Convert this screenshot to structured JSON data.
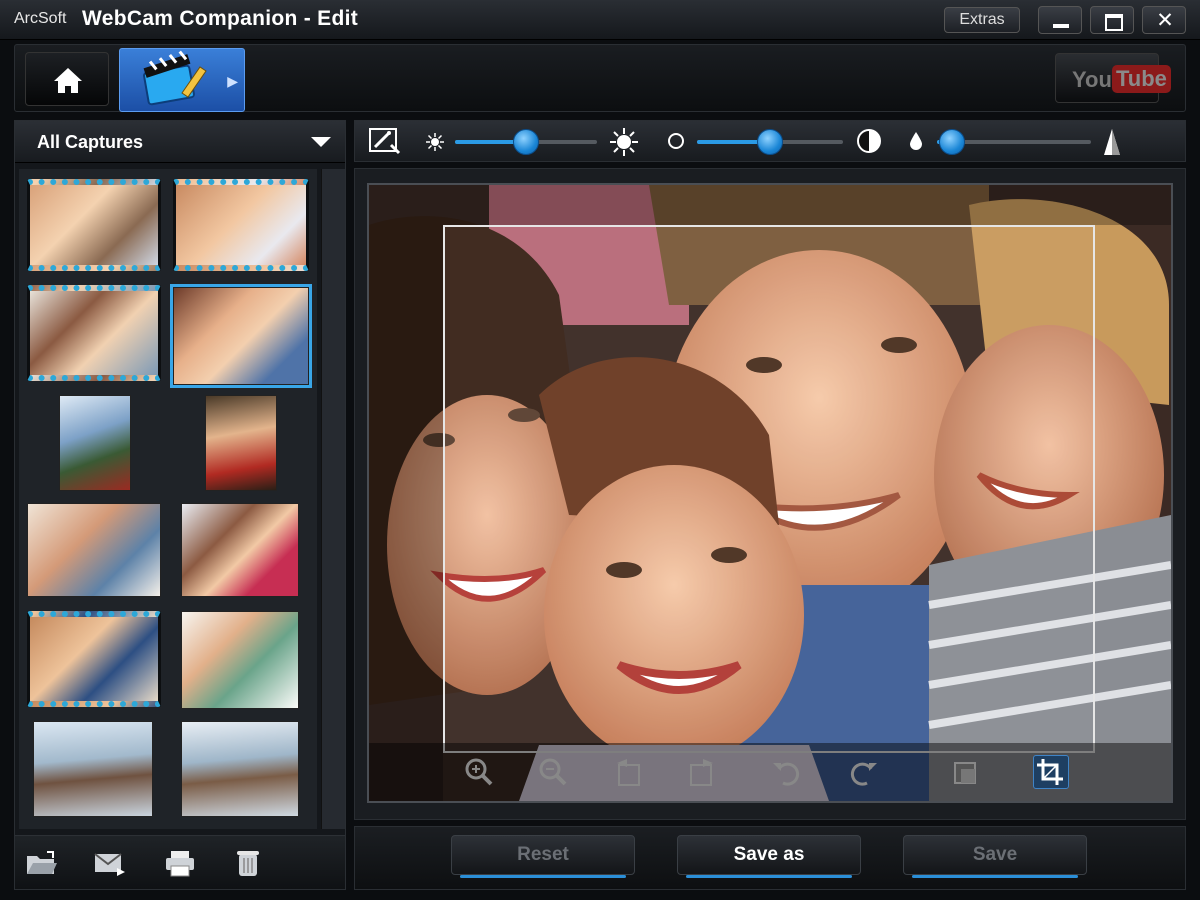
{
  "window": {
    "brand": "ArcSoft",
    "title": "WebCam Companion - Edit",
    "extras_label": "Extras",
    "close_glyph": "✕"
  },
  "nav": {
    "home_icon": "home-icon",
    "edit_icon": "clapperboard-edit-icon",
    "youtube_you": "You",
    "youtube_tube": "Tube"
  },
  "captures": {
    "filter_label": "All Captures",
    "thumbnails": [
      {
        "style": "filmstrip",
        "selected": false
      },
      {
        "style": "filmstrip",
        "selected": false
      },
      {
        "style": "filmstrip",
        "selected": false
      },
      {
        "style": "photo",
        "selected": true
      },
      {
        "style": "photo",
        "selected": false
      },
      {
        "style": "photo",
        "selected": false
      },
      {
        "style": "photo",
        "selected": false
      },
      {
        "style": "photo",
        "selected": false
      },
      {
        "style": "filmstrip",
        "selected": false
      },
      {
        "style": "photo",
        "selected": false
      },
      {
        "style": "photo",
        "selected": false
      },
      {
        "style": "photo",
        "selected": false
      }
    ],
    "tools": [
      "open-folder-icon",
      "email-icon",
      "print-icon",
      "trash-icon"
    ]
  },
  "adjustments": {
    "brightness": 0.5,
    "contrast": 0.5,
    "saturation": 0.1
  },
  "image_tools": [
    "zoom-in-icon",
    "zoom-out-icon",
    "rotate-left-icon",
    "rotate-right-icon",
    "undo-icon",
    "redo-icon",
    "fit-icon",
    "crop-icon"
  ],
  "actions": {
    "reset": "Reset",
    "save_as": "Save as",
    "save": "Save"
  },
  "colors": {
    "accent": "#2b9be6",
    "selected_tab": "#2f6fc7"
  }
}
